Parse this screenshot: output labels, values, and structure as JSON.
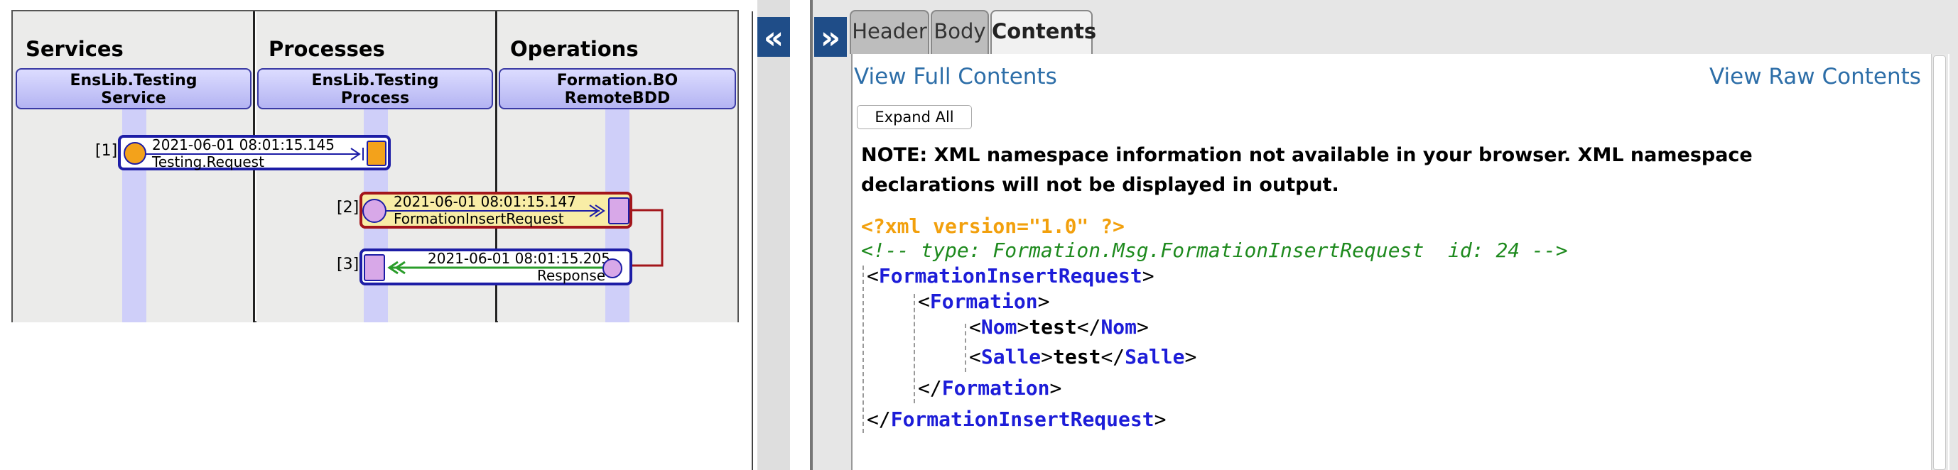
{
  "trace": {
    "columns": [
      {
        "title": "Services",
        "host_line1": "EnsLib.Testing",
        "host_line2": "Service"
      },
      {
        "title": "Processes",
        "host_line1": "EnsLib.Testing",
        "host_line2": "Process"
      },
      {
        "title": "Operations",
        "host_line1": "Formation.BO",
        "host_line2": "RemoteBDD"
      }
    ],
    "messages": [
      {
        "index": "[1]",
        "timestamp": "2021-06-01 08:01:15.145",
        "name": "Testing.Request"
      },
      {
        "index": "[2]",
        "timestamp": "2021-06-01 08:01:15.147",
        "name": "FormationInsertRequest",
        "selected": true
      },
      {
        "index": "[3]",
        "timestamp": "2021-06-01 08:01:15.205",
        "name": "Response"
      }
    ],
    "collapse_glyph": "«",
    "colors": {
      "request_arrow": "#1d1dd8",
      "response_arrow": "#2a9d2a",
      "selected_border": "#a3161b",
      "selected_fill": "#f8eda6"
    }
  },
  "details": {
    "expand_glyph": "»",
    "tabs": [
      {
        "label": "Header",
        "active": false
      },
      {
        "label": "Body",
        "active": false
      },
      {
        "label": "Contents",
        "active": true
      }
    ],
    "view_full_label": "View Full Contents",
    "view_raw_label": "View Raw Contents",
    "expand_all_label": "Expand All",
    "note": "NOTE: XML namespace information not available in your browser. XML namespace declarations will not be displayed in output.",
    "xml": {
      "decl": "<?xml version=\"1.0\" ?>",
      "comment": "<!-- type: Formation.Msg.FormationInsertRequest  id: 24 -->",
      "root": "FormationInsertRequest",
      "child": "Formation",
      "fields": [
        {
          "tag": "Nom",
          "value": "test"
        },
        {
          "tag": "Salle",
          "value": "test"
        }
      ]
    }
  }
}
